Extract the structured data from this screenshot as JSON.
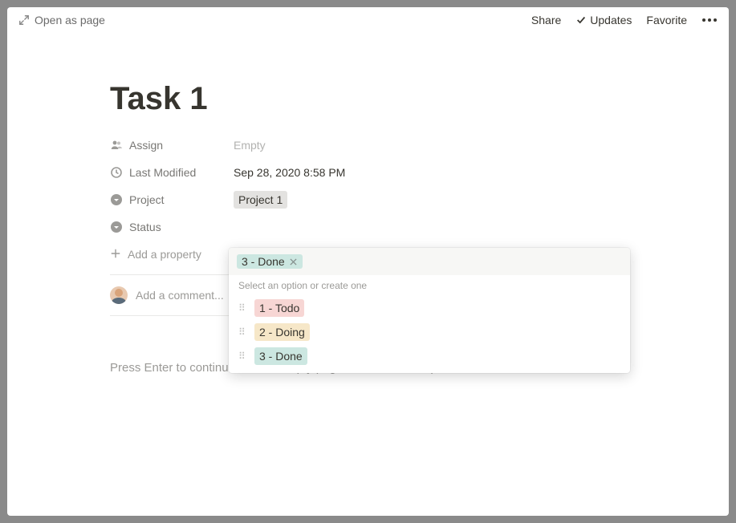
{
  "topbar": {
    "open_as_page": "Open as page",
    "share": "Share",
    "updates": "Updates",
    "favorite": "Favorite"
  },
  "page": {
    "title": "Task 1",
    "empty_hint_prefix": "Press Enter to continue with an empty page, or ",
    "empty_hint_link": "create a template"
  },
  "properties": {
    "assign": {
      "label": "Assign",
      "value": "Empty"
    },
    "last_modified": {
      "label": "Last Modified",
      "value": "Sep 28, 2020 8:58 PM"
    },
    "project": {
      "label": "Project",
      "value": "Project 1"
    },
    "status": {
      "label": "Status"
    },
    "add_property": "Add a property"
  },
  "comment": {
    "placeholder": "Add a comment..."
  },
  "dropdown": {
    "selected": "3 - Done",
    "hint": "Select an option or create one",
    "options": [
      {
        "label": "1 - Todo",
        "color": "pink"
      },
      {
        "label": "2 - Doing",
        "color": "yellow"
      },
      {
        "label": "3 - Done",
        "color": "green"
      }
    ]
  }
}
